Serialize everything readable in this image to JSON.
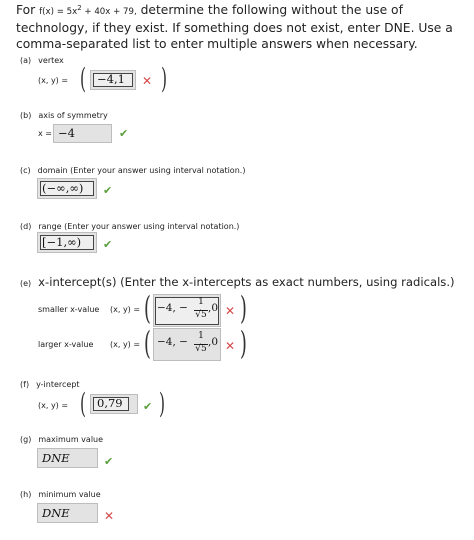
{
  "intro": {
    "prefix": "For",
    "function": "f(x) = 5x",
    "exponent": "2",
    "function_rest": "+ 40x + 79,",
    "text": "determine the following without the use of technology, if they exist. If something does not exist, enter DNE. Use a comma-separated list to enter multiple answers when necessary."
  },
  "parts": {
    "a": {
      "letter": "(a)",
      "label": "vertex",
      "eq": "(x, y) =",
      "answer": "−4,1",
      "status": "incorrect"
    },
    "b": {
      "letter": "(b)",
      "label": "axis of symmetry",
      "eq": "x =",
      "answer": "−4",
      "status": "correct"
    },
    "c": {
      "letter": "(c)",
      "label": "domain (Enter your answer using interval notation.)",
      "answer": "(−∞,∞)",
      "status": "correct"
    },
    "d": {
      "letter": "(d)",
      "label": "range (Enter your answer using interval notation.)",
      "answer": "[−1,∞)",
      "status": "correct"
    },
    "e": {
      "letter": "(e)",
      "label": "x-intercept(s) (Enter the x-intercepts as exact numbers, using radicals.)",
      "smaller_label": "smaller x-value",
      "larger_label": "larger x-value",
      "eq": "(x, y) =",
      "smaller_answer_lead": "−4, −",
      "smaller_num": "1",
      "smaller_den": "√5",
      "smaller_tail": ",0",
      "larger_answer_lead": "−4, −",
      "larger_num": "1",
      "larger_den": "√5",
      "larger_tail": ",0",
      "smaller_status": "incorrect",
      "larger_status": "incorrect"
    },
    "f": {
      "letter": "(f)",
      "label": "y-intercept",
      "eq": "(x, y) =",
      "answer": "0,79",
      "status": "correct"
    },
    "g": {
      "letter": "(g)",
      "label": "maximum value",
      "answer": "DNE",
      "status": "correct"
    },
    "h": {
      "letter": "(h)",
      "label": "minimum value",
      "answer": "DNE",
      "status": "incorrect"
    }
  },
  "icons": {
    "correct": "check-mark-icon",
    "incorrect": "cross-mark-icon"
  },
  "colors": {
    "correct": "#5a9e3a",
    "incorrect": "#d64a4a",
    "answer_box_bg": "#e3e3e3"
  }
}
